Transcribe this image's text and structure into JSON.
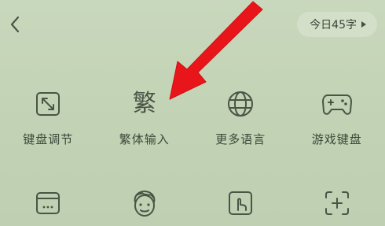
{
  "header": {
    "counter_text": "今日45字"
  },
  "grid": {
    "row1": [
      {
        "label": "键盘调节",
        "icon": "resize-icon"
      },
      {
        "label": "繁体输入",
        "icon": "traditional-char-icon",
        "glyph": "繁"
      },
      {
        "label": "更多语言",
        "icon": "globe-icon"
      },
      {
        "label": "游戏键盘",
        "icon": "gamepad-icon"
      }
    ],
    "row2": [
      {
        "icon": "keyboard-window-icon"
      },
      {
        "icon": "face-avatar-icon"
      },
      {
        "icon": "hand-tap-icon"
      },
      {
        "icon": "add-frame-icon"
      }
    ]
  },
  "colors": {
    "background": "#c4d4b6",
    "arrow": "#e8161b",
    "icon_stroke": "#4a5546"
  }
}
